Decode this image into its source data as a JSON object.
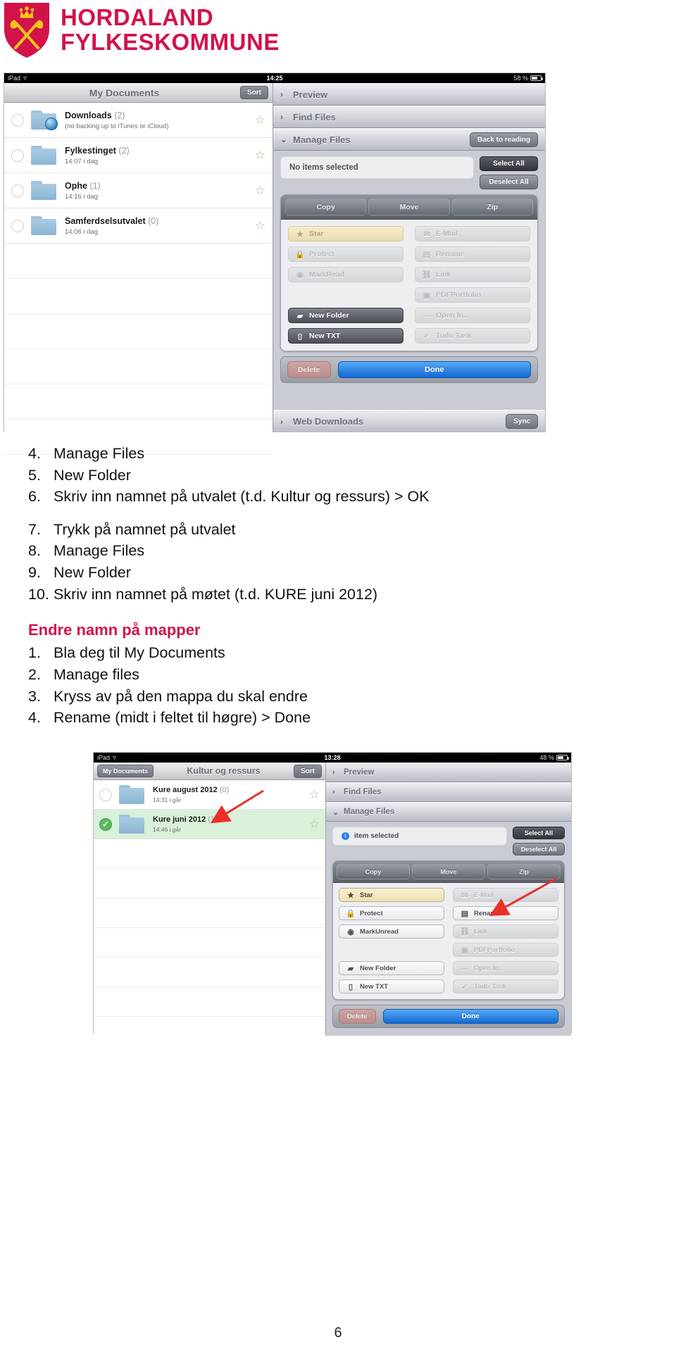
{
  "logo": {
    "line1": "HORDALAND",
    "line2": "FYLKESKOMMUNE",
    "brand_color": "#d1134a",
    "shield_icon": "coat-of-arms-shield"
  },
  "screenshot1": {
    "status_bar": {
      "device": "iPad",
      "wifi_icon": "wifi-icon",
      "time": "14:25",
      "battery": "58 %",
      "battery_icon": "battery-icon"
    },
    "left_pane": {
      "title": "My Documents",
      "sort_button": "Sort",
      "rows": [
        {
          "name": "Downloads",
          "count": "(2)",
          "sub": "(no backing up to iTunes or iCloud)",
          "icon": "folder-downloads-icon",
          "star": "☆",
          "selected": false
        },
        {
          "name": "Fylkestinget",
          "count": "(2)",
          "sub": "14:07 i dag",
          "icon": "folder-icon",
          "star": "☆",
          "selected": false
        },
        {
          "name": "Ophe",
          "count": "(1)",
          "sub": "14:16 i dag",
          "icon": "folder-icon",
          "star": "☆",
          "selected": false
        },
        {
          "name": "Samferdselsutvalet",
          "count": "(0)",
          "sub": "14:06 i dag",
          "icon": "folder-icon",
          "star": "☆",
          "selected": false
        }
      ],
      "empty_rows": 6
    },
    "right_pane": {
      "sections": [
        {
          "label": "Preview",
          "chevron": "›",
          "expanded": false
        },
        {
          "label": "Find Files",
          "chevron": "›",
          "expanded": false
        },
        {
          "label": "Manage Files",
          "chevron": "⌄",
          "expanded": true,
          "button": "Back to reading"
        }
      ],
      "selection_status": "No items selected",
      "select_all": "Select All",
      "deselect_all": "Deselect All",
      "top_buttons": [
        "Copy",
        "Move",
        "Zip"
      ],
      "grid_buttons": [
        {
          "label": "Star",
          "icon": "star-icon",
          "state": "star"
        },
        {
          "label": "E-Mail",
          "icon": "envelope-icon",
          "state": "disabled"
        },
        {
          "label": "Protect",
          "icon": "lock-icon",
          "state": "disabled"
        },
        {
          "label": "Rename",
          "icon": "rename-icon",
          "state": "disabled"
        },
        {
          "label": "MarkRead",
          "icon": "eye-icon",
          "state": "disabled"
        },
        {
          "label": "Link",
          "icon": "link-icon",
          "state": "disabled"
        },
        {
          "label": "",
          "icon": "",
          "state": "spacer"
        },
        {
          "label": "PDFPortfolio",
          "icon": "pdf-portfolio-icon",
          "state": "disabled"
        },
        {
          "label": "New Folder",
          "icon": "new-folder-icon",
          "state": "active"
        },
        {
          "label": "Open In...",
          "icon": "open-in-icon",
          "state": "disabled"
        },
        {
          "label": "New TXT",
          "icon": "new-txt-icon",
          "state": "active"
        },
        {
          "label": "Todo Task",
          "icon": "check-icon",
          "state": "disabled"
        }
      ],
      "delete_button": "Delete",
      "done_button": "Done",
      "web_downloads": {
        "label": "Web Downloads",
        "chevron": "›",
        "button": "Sync"
      }
    }
  },
  "instructions": {
    "steps_top": [
      {
        "num": "4.",
        "text": "Manage Files"
      },
      {
        "num": "5.",
        "text": "New Folder"
      },
      {
        "num": "6.",
        "text": "Skriv inn namnet på utvalet (t.d. Kultur og ressurs) > OK"
      }
    ],
    "steps_mid": [
      {
        "num": "7.",
        "text": "Trykk på namnet på utvalet"
      },
      {
        "num": "8.",
        "text": "Manage Files"
      },
      {
        "num": "9.",
        "text": "New Folder"
      },
      {
        "num": "10.",
        "text": "Skriv inn namnet på møtet (t.d. KURE juni 2012)"
      }
    ],
    "section_heading": "Endre namn på mapper",
    "steps_rename": [
      {
        "num": "1.",
        "text": "Bla deg til My Documents"
      },
      {
        "num": "2.",
        "text": "Manage files"
      },
      {
        "num": "3.",
        "text": "Kryss av på den mappa du skal endre"
      },
      {
        "num": "4.",
        "text": "Rename (midt i feltet til høgre) > Done"
      }
    ]
  },
  "screenshot2": {
    "status_bar": {
      "device": "iPad",
      "wifi_icon": "wifi-icon",
      "time": "13:28",
      "battery": "48 %",
      "battery_icon": "battery-icon"
    },
    "left_pane": {
      "back_button": "My Documents",
      "title": "Kultur og ressurs",
      "sort_button": "Sort",
      "rows": [
        {
          "name": "Kure august 2012",
          "count": "(0)",
          "sub": "14:31 i går",
          "icon": "folder-icon",
          "star": "☆",
          "selected": false
        },
        {
          "name": "Kure juni 2012",
          "count": "(1)",
          "sub": "14:46 i går",
          "icon": "folder-icon",
          "star": "☆",
          "selected": true
        }
      ],
      "empty_rows": 6
    },
    "right_pane": {
      "sections": [
        {
          "label": "Preview",
          "chevron": "›",
          "expanded": false
        },
        {
          "label": "Find Files",
          "chevron": "›",
          "expanded": false
        },
        {
          "label": "Manage Files",
          "chevron": "⌄",
          "expanded": true
        }
      ],
      "selection_status": "item selected",
      "select_all": "Select All",
      "deselect_all": "Deselect All",
      "top_buttons": [
        "Copy",
        "Move",
        "Zip"
      ],
      "grid_buttons": [
        {
          "label": "Star",
          "icon": "star-icon",
          "state": "star-active"
        },
        {
          "label": "E-Mail",
          "icon": "envelope-icon",
          "state": "disabled"
        },
        {
          "label": "Protect",
          "icon": "lock-icon",
          "state": "enabled"
        },
        {
          "label": "Rename",
          "icon": "rename-icon",
          "state": "enabled"
        },
        {
          "label": "MarkUnread",
          "icon": "eye-icon",
          "state": "enabled"
        },
        {
          "label": "Link",
          "icon": "link-icon",
          "state": "disabled"
        },
        {
          "label": "",
          "icon": "",
          "state": "spacer"
        },
        {
          "label": "PDFPortfolio",
          "icon": "pdf-portfolio-icon",
          "state": "disabled"
        },
        {
          "label": "New Folder",
          "icon": "new-folder-icon",
          "state": "enabled"
        },
        {
          "label": "Open In...",
          "icon": "open-in-icon",
          "state": "disabled"
        },
        {
          "label": "New TXT",
          "icon": "new-txt-icon",
          "state": "enabled"
        },
        {
          "label": "Todo Task",
          "icon": "check-icon",
          "state": "disabled"
        }
      ],
      "delete_button": "Delete",
      "done_button": "Done"
    },
    "annotation_arrows": 2,
    "arrow_color": "#e8302a"
  },
  "page_number": "6"
}
